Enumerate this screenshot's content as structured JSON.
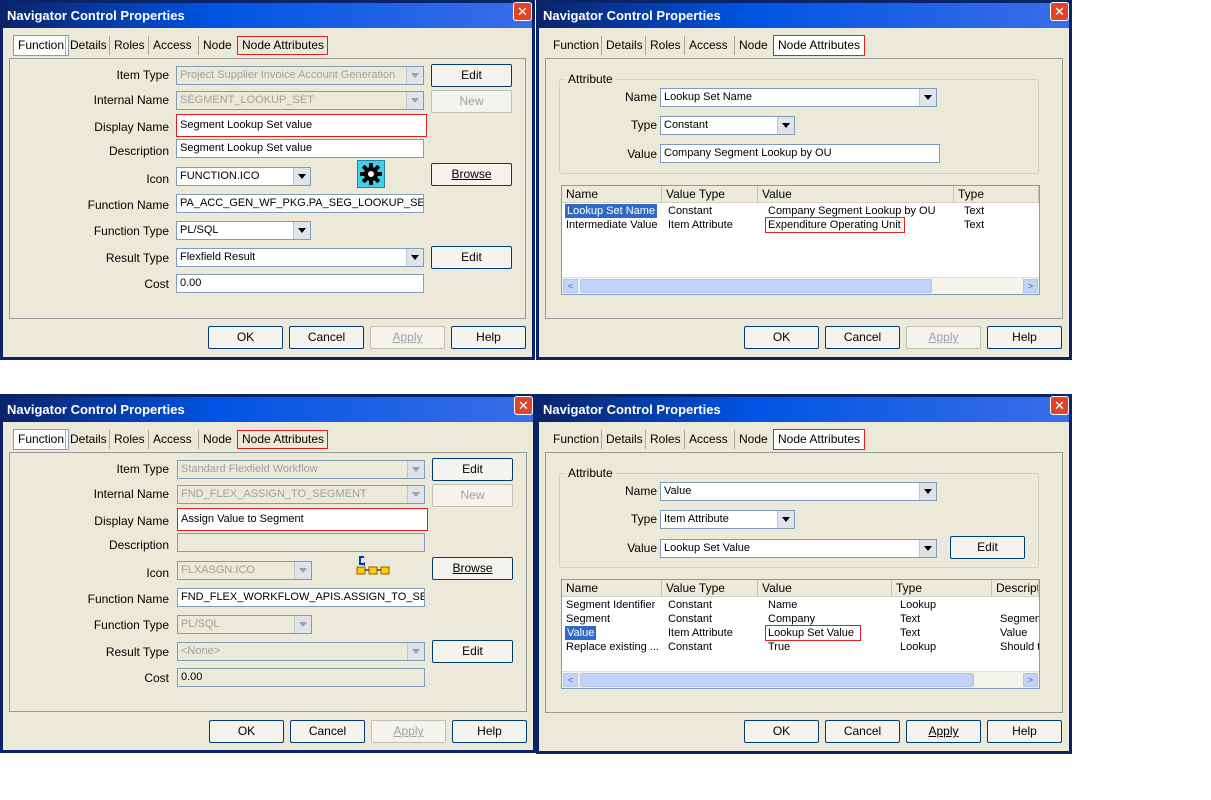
{
  "dialogs": [
    {
      "title": "Navigator Control Properties",
      "tabs": [
        "Function",
        "Details",
        "Roles",
        "Access",
        "Node",
        "Node Attributes"
      ],
      "labels": {
        "item_type": "Item Type",
        "internal_name": "Internal Name",
        "display_name": "Display Name",
        "description": "Description",
        "icon": "Icon",
        "function_name": "Function Name",
        "function_type": "Function Type",
        "result_type": "Result Type",
        "cost": "Cost"
      },
      "values": {
        "item_type": "Project Supplier Invoice Account Generation",
        "internal_name": "SEGMENT_LOOKUP_SET",
        "display_name": "Segment Lookup Set value",
        "description": "Segment Lookup Set value",
        "icon": "FUNCTION.ICO",
        "function_name": "PA_ACC_GEN_WF_PKG.PA_SEG_LOOKUP_SET",
        "function_type": "PL/SQL",
        "result_type": "Flexfield Result",
        "cost": "0.00"
      },
      "side_buttons": {
        "edit": "Edit",
        "new": "New",
        "browse": "Browse",
        "edit2": "Edit"
      },
      "footer": {
        "ok": "OK",
        "cancel": "Cancel",
        "apply": "Apply",
        "help": "Help"
      }
    },
    {
      "title": "Navigator Control Properties",
      "tabs": [
        "Function",
        "Details",
        "Roles",
        "Access",
        "Node",
        "Node Attributes"
      ],
      "attribute_group": "Attribute",
      "labels": {
        "name": "Name",
        "type": "Type",
        "value": "Value"
      },
      "values": {
        "name": "Lookup Set Name",
        "type": "Constant",
        "value": "Company Segment Lookup by OU"
      },
      "columns": [
        "Name",
        "Value Type",
        "Value",
        "Type"
      ],
      "rows": [
        [
          "Lookup Set Name",
          "Constant",
          "Company Segment Lookup by OU",
          "Text"
        ],
        [
          "Intermediate Value",
          "Item Attribute",
          "Expenditure Operating Unit",
          "Text"
        ]
      ],
      "footer": {
        "ok": "OK",
        "cancel": "Cancel",
        "apply": "Apply",
        "help": "Help"
      }
    },
    {
      "title": "Navigator Control Properties",
      "tabs": [
        "Function",
        "Details",
        "Roles",
        "Access",
        "Node",
        "Node Attributes"
      ],
      "labels": {
        "item_type": "Item Type",
        "internal_name": "Internal Name",
        "display_name": "Display Name",
        "description": "Description",
        "icon": "Icon",
        "function_name": "Function Name",
        "function_type": "Function Type",
        "result_type": "Result Type",
        "cost": "Cost"
      },
      "values": {
        "item_type": "Standard Flexfield Workflow",
        "internal_name": "FND_FLEX_ASSIGN_TO_SEGMENT",
        "display_name": "Assign Value to Segment",
        "description": "",
        "icon": "FLXASGN.ICO",
        "function_name": "FND_FLEX_WORKFLOW_APIS.ASSIGN_TO_SE",
        "function_type": "PL/SQL",
        "result_type": "<None>",
        "cost": "0.00"
      },
      "side_buttons": {
        "edit": "Edit",
        "new": "New",
        "browse": "Browse",
        "edit2": "Edit"
      },
      "footer": {
        "ok": "OK",
        "cancel": "Cancel",
        "apply": "Apply",
        "help": "Help"
      }
    },
    {
      "title": "Navigator Control Properties",
      "tabs": [
        "Function",
        "Details",
        "Roles",
        "Access",
        "Node",
        "Node Attributes"
      ],
      "attribute_group": "Attribute",
      "labels": {
        "name": "Name",
        "type": "Type",
        "value": "Value"
      },
      "values": {
        "name": "Value",
        "type": "Item Attribute",
        "value": "Lookup Set Value"
      },
      "edit_button": "Edit",
      "columns": [
        "Name",
        "Value Type",
        "Value",
        "Type",
        "Descript"
      ],
      "rows": [
        [
          "Segment Identifier",
          "Constant",
          "Name",
          "Lookup",
          ""
        ],
        [
          "Segment",
          "Constant",
          "Company",
          "Text",
          "Segmen"
        ],
        [
          "Value",
          "Item Attribute",
          "Lookup Set Value",
          "Text",
          "Value"
        ],
        [
          "Replace existing ...",
          "Constant",
          "True",
          "Lookup",
          "Should t"
        ]
      ],
      "footer": {
        "ok": "OK",
        "cancel": "Cancel",
        "apply": "Apply",
        "help": "Help"
      }
    }
  ],
  "colors": {
    "title_bar": "#0a246a",
    "highlight_border": "#e02020",
    "dialog_bg": "#ece9d8",
    "selection": "#316ac5"
  }
}
